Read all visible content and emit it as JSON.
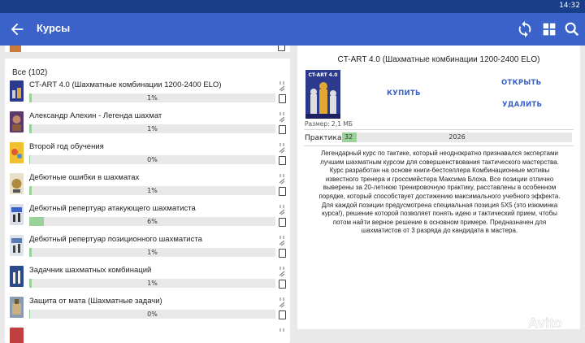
{
  "status_bar": {
    "time": "14:32"
  },
  "app_bar": {
    "title": "Курсы",
    "icons": [
      "back-arrow-icon",
      "sync-icon",
      "grid-icon",
      "search-icon"
    ],
    "color": "#3a62c9"
  },
  "course_list": {
    "header": "Все (102)",
    "items": [
      {
        "title": "CT-ART 4.0 (Шахматные комбинации 1200-2400 ELO)",
        "progress": 1,
        "progress_label": "1%"
      },
      {
        "title": "Александр Алехин - Легенда шахмат",
        "progress": 1,
        "progress_label": "1%"
      },
      {
        "title": "Второй год обучения",
        "progress": 0,
        "progress_label": "0%"
      },
      {
        "title": "Дебютные ошибки в шахматах",
        "progress": 1,
        "progress_label": "1%"
      },
      {
        "title": "Дебютный репертуар атакующего шахматиста",
        "progress": 6,
        "progress_label": "6%"
      },
      {
        "title": "Дебютный репертуар позиционного шахматиста",
        "progress": 1,
        "progress_label": "1%"
      },
      {
        "title": "Задачник шахматных комбинаций",
        "progress": 1,
        "progress_label": "1%"
      },
      {
        "title": "Защита от мата (Шахматные задачи)",
        "progress": 0,
        "progress_label": "0%"
      }
    ]
  },
  "detail": {
    "title": "CT-ART 4.0 (Шахматные комбинации 1200-2400 ELO)",
    "cover_text": "CT-ART 4.0",
    "size": "Размер: 2,1 МБ",
    "buy_label": "КУПИТЬ",
    "open_label": "ОТКРЫТЬ",
    "delete_label": "УДАЛИТЬ",
    "practice_label": "Практика:",
    "practice_done": "32",
    "practice_total": "2026",
    "practice_done_value": 32,
    "practice_total_value": 2026,
    "description": "Легендарный курс по тактике, который неоднократно признавался экспертами лучшим шахматным курсом для совершенствования тактического мастерства. Курс разработан на основе книги-бестселлера Комбинационные мотивы известного тренера и гроссмейстера Максима Блоха. Все позиции отлично выверены за 20-летнюю тренировочную практику, расставлены в особенном порядке, который способствует достижению максимального учебного эффекта. Для каждой позиции предусмотрена специальная позиция 5Х5 (это изюминка курса!), решение которой позволяет понять идею и тактический прием, чтобы потом найти верное решение в основном примере. Предназначен для шахматистов от 3 разряда до кандидата в мастера."
  },
  "watermark": "Avito"
}
